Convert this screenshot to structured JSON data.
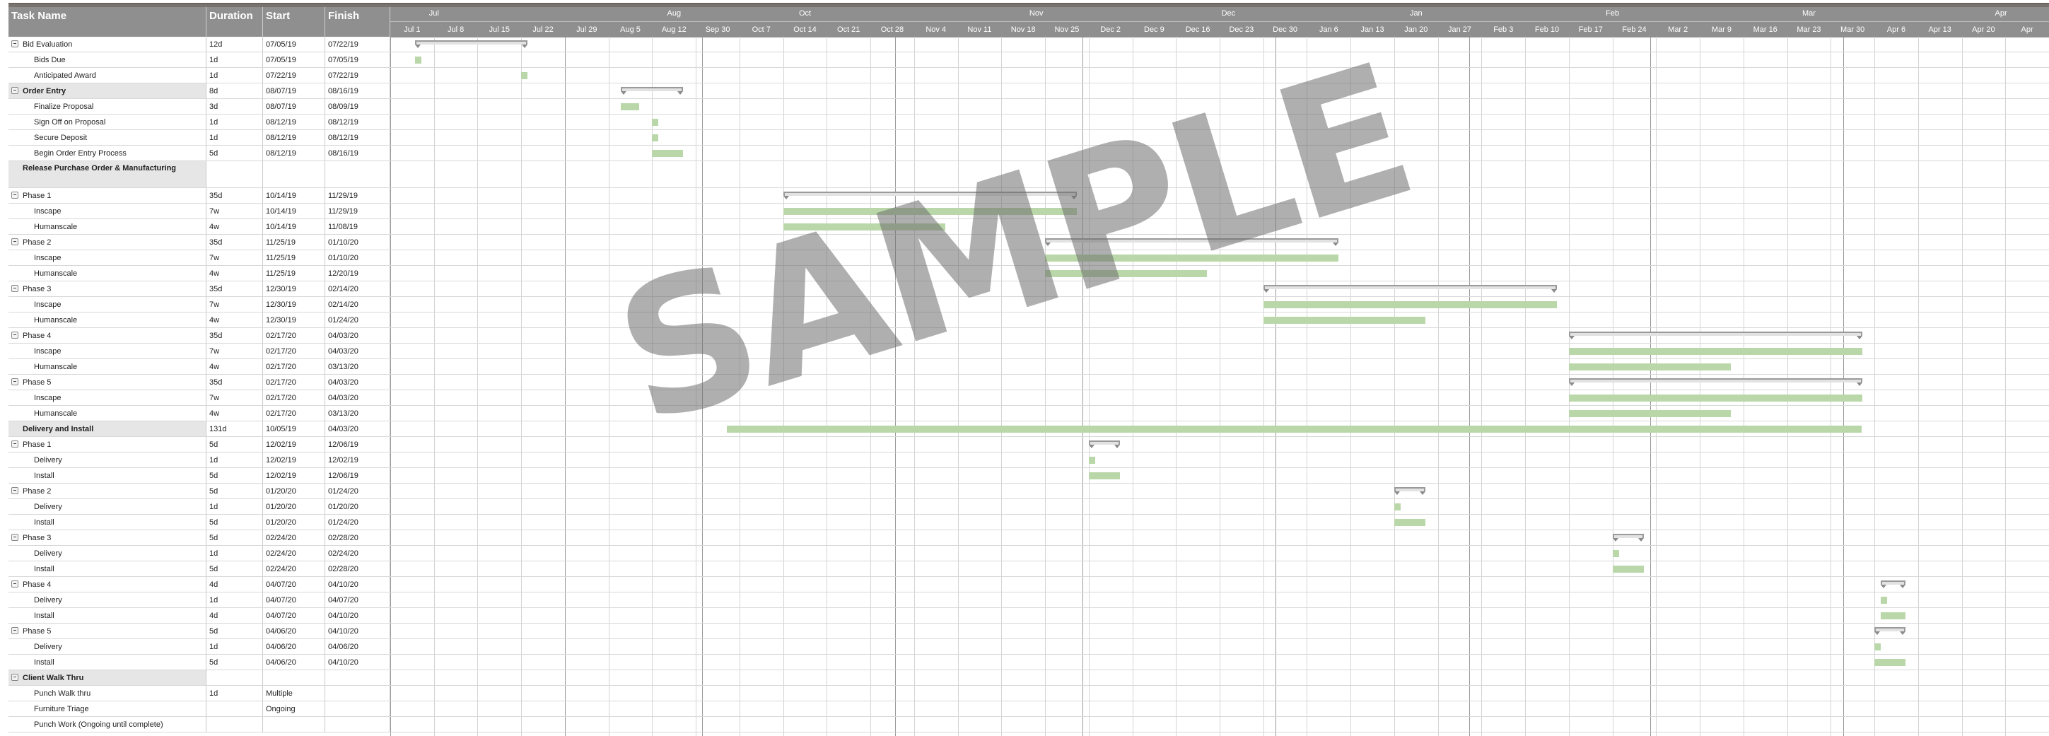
{
  "columns": {
    "task": "Task Name",
    "duration": "Duration",
    "start": "Start",
    "finish": "Finish"
  },
  "timeline": {
    "months": [
      {
        "label": "Jul",
        "wk": 1
      },
      {
        "label": "Aug",
        "wk": 6.5
      },
      {
        "label": "Oct",
        "wk": 9.5
      },
      {
        "label": "Nov",
        "wk": 14.8
      },
      {
        "label": "Dec",
        "wk": 19.2
      },
      {
        "label": "Jan",
        "wk": 23.5
      },
      {
        "label": "Feb",
        "wk": 28
      },
      {
        "label": "Mar",
        "wk": 32.5
      },
      {
        "label": "Apr",
        "wk": 36.9
      }
    ],
    "weeks": [
      "Jul 1",
      "Jul 8",
      "Jul 15",
      "Jul 22",
      "Jul 29",
      "Aug 5",
      "Aug 12",
      "Sep 30",
      "Oct 7",
      "Oct 14",
      "Oct 21",
      "Oct 28",
      "Nov 4",
      "Nov 11",
      "Nov 18",
      "Nov 25",
      "Dec 2",
      "Dec 9",
      "Dec 16",
      "Dec 23",
      "Dec 30",
      "Jan 6",
      "Jan 13",
      "Jan 20",
      "Jan 27",
      "Feb 3",
      "Feb 10",
      "Feb 17",
      "Feb 24",
      "Mar 2",
      "Mar 9",
      "Mar 16",
      "Mar 23",
      "Mar 30",
      "Apr 6",
      "Apr 13",
      "Apr 20",
      "Apr"
    ],
    "week_dates": [
      "2019-07-01",
      "2019-07-08",
      "2019-07-15",
      "2019-07-22",
      "2019-07-29",
      "2019-08-05",
      "2019-08-12",
      "2019-09-30",
      "2019-10-07",
      "2019-10-14",
      "2019-10-21",
      "2019-10-28",
      "2019-11-04",
      "2019-11-11",
      "2019-11-18",
      "2019-11-25",
      "2019-12-02",
      "2019-12-09",
      "2019-12-16",
      "2019-12-23",
      "2019-12-30",
      "2020-01-06",
      "2020-01-13",
      "2020-01-20",
      "2020-01-27",
      "2020-02-03",
      "2020-02-10",
      "2020-02-17",
      "2020-02-24",
      "2020-03-02",
      "2020-03-09",
      "2020-03-16",
      "2020-03-23",
      "2020-03-30",
      "2020-04-06",
      "2020-04-13",
      "2020-04-20",
      "2020-04-27"
    ],
    "month_boundaries": [
      "2019-07-01",
      "2019-07-29",
      "2019-10-01",
      "2019-11-01",
      "2019-12-01",
      "2020-01-01",
      "2020-02-01",
      "2020-03-01",
      "2020-04-01"
    ]
  },
  "tasks": [
    {
      "name": "Bid Evaluation",
      "dur": "12d",
      "start": "07/05/19",
      "finish": "07/22/19",
      "level": "g",
      "collapse": true,
      "type": "summary",
      "s": "2019-07-05",
      "f": "2019-07-22"
    },
    {
      "name": "Bids Due",
      "dur": "1d",
      "start": "07/05/19",
      "finish": "07/05/19",
      "level": "s",
      "type": "bar",
      "s": "2019-07-05",
      "f": "2019-07-05"
    },
    {
      "name": "Anticipated Award",
      "dur": "1d",
      "start": "07/22/19",
      "finish": "07/22/19",
      "level": "s",
      "type": "bar",
      "s": "2019-07-22",
      "f": "2019-07-22"
    },
    {
      "name": "Order Entry",
      "dur": "8d",
      "start": "08/07/19",
      "finish": "08/16/19",
      "level": "h",
      "collapse": true,
      "type": "summary",
      "s": "2019-08-07",
      "f": "2019-08-16"
    },
    {
      "name": "Finalize Proposal",
      "dur": "3d",
      "start": "08/07/19",
      "finish": "08/09/19",
      "level": "s",
      "type": "bar",
      "s": "2019-08-07",
      "f": "2019-08-09"
    },
    {
      "name": "Sign Off on Proposal",
      "dur": "1d",
      "start": "08/12/19",
      "finish": "08/12/19",
      "level": "s",
      "type": "bar",
      "s": "2019-08-12",
      "f": "2019-08-12"
    },
    {
      "name": "Secure Deposit",
      "dur": "1d",
      "start": "08/12/19",
      "finish": "08/12/19",
      "level": "s",
      "type": "bar",
      "s": "2019-08-12",
      "f": "2019-08-12"
    },
    {
      "name": "Begin Order Entry Process",
      "dur": "5d",
      "start": "08/12/19",
      "finish": "08/16/19",
      "level": "s",
      "type": "bar",
      "s": "2019-08-12",
      "f": "2019-08-16"
    },
    {
      "name": "Release Purchase Order & Manufacturing",
      "dur": "",
      "start": "",
      "finish": "",
      "level": "h",
      "tall": true,
      "type": "none"
    },
    {
      "name": "Phase 1",
      "dur": "35d",
      "start": "10/14/19",
      "finish": "11/29/19",
      "level": "g",
      "collapse": true,
      "type": "summary",
      "s": "2019-10-14",
      "f": "2019-11-29"
    },
    {
      "name": "Inscape",
      "dur": "7w",
      "start": "10/14/19",
      "finish": "11/29/19",
      "level": "s",
      "type": "bar",
      "s": "2019-10-14",
      "f": "2019-11-29"
    },
    {
      "name": "Humanscale",
      "dur": "4w",
      "start": "10/14/19",
      "finish": "11/08/19",
      "level": "s",
      "type": "bar",
      "s": "2019-10-14",
      "f": "2019-11-08"
    },
    {
      "name": "Phase 2",
      "dur": "35d",
      "start": "11/25/19",
      "finish": "01/10/20",
      "level": "g",
      "collapse": true,
      "type": "summary",
      "s": "2019-11-25",
      "f": "2020-01-10"
    },
    {
      "name": "Inscape",
      "dur": "7w",
      "start": "11/25/19",
      "finish": "01/10/20",
      "level": "s",
      "type": "bar",
      "s": "2019-11-25",
      "f": "2020-01-10"
    },
    {
      "name": "Humanscale",
      "dur": "4w",
      "start": "11/25/19",
      "finish": "12/20/19",
      "level": "s",
      "type": "bar",
      "s": "2019-11-25",
      "f": "2019-12-20"
    },
    {
      "name": "Phase 3",
      "dur": "35d",
      "start": "12/30/19",
      "finish": "02/14/20",
      "level": "g",
      "collapse": true,
      "type": "summary",
      "s": "2019-12-30",
      "f": "2020-02-14"
    },
    {
      "name": "Inscape",
      "dur": "7w",
      "start": "12/30/19",
      "finish": "02/14/20",
      "level": "s",
      "type": "bar",
      "s": "2019-12-30",
      "f": "2020-02-14"
    },
    {
      "name": "Humanscale",
      "dur": "4w",
      "start": "12/30/19",
      "finish": "01/24/20",
      "level": "s",
      "type": "bar",
      "s": "2019-12-30",
      "f": "2020-01-24"
    },
    {
      "name": "Phase 4",
      "dur": "35d",
      "start": "02/17/20",
      "finish": "04/03/20",
      "level": "g",
      "collapse": true,
      "type": "summary",
      "s": "2020-02-17",
      "f": "2020-04-03"
    },
    {
      "name": "Inscape",
      "dur": "7w",
      "start": "02/17/20",
      "finish": "04/03/20",
      "level": "s",
      "type": "bar",
      "s": "2020-02-17",
      "f": "2020-04-03"
    },
    {
      "name": "Humanscale",
      "dur": "4w",
      "start": "02/17/20",
      "finish": "03/13/20",
      "level": "s",
      "type": "bar",
      "s": "2020-02-17",
      "f": "2020-03-13"
    },
    {
      "name": "Phase 5",
      "dur": "35d",
      "start": "02/17/20",
      "finish": "04/03/20",
      "level": "g",
      "collapse": true,
      "type": "summary",
      "s": "2020-02-17",
      "f": "2020-04-03"
    },
    {
      "name": "Inscape",
      "dur": "7w",
      "start": "02/17/20",
      "finish": "04/03/20",
      "level": "s",
      "type": "bar",
      "s": "2020-02-17",
      "f": "2020-04-03"
    },
    {
      "name": "Humanscale",
      "dur": "4w",
      "start": "02/17/20",
      "finish": "03/13/20",
      "level": "s",
      "type": "bar",
      "s": "2020-02-17",
      "f": "2020-03-13"
    },
    {
      "name": "Delivery and Install",
      "dur": "131d",
      "start": "10/05/19",
      "finish": "04/03/20",
      "level": "h",
      "type": "bar",
      "s": "2019-10-05",
      "f": "2020-04-03"
    },
    {
      "name": "Phase 1",
      "dur": "5d",
      "start": "12/02/19",
      "finish": "12/06/19",
      "level": "g",
      "collapse": true,
      "type": "summary",
      "s": "2019-12-02",
      "f": "2019-12-06"
    },
    {
      "name": "Delivery",
      "dur": "1d",
      "start": "12/02/19",
      "finish": "12/02/19",
      "level": "s",
      "type": "bar",
      "s": "2019-12-02",
      "f": "2019-12-02"
    },
    {
      "name": "Install",
      "dur": "5d",
      "start": "12/02/19",
      "finish": "12/06/19",
      "level": "s",
      "type": "bar",
      "s": "2019-12-02",
      "f": "2019-12-06"
    },
    {
      "name": "Phase 2",
      "dur": "5d",
      "start": "01/20/20",
      "finish": "01/24/20",
      "level": "g",
      "collapse": true,
      "type": "summary",
      "s": "2020-01-20",
      "f": "2020-01-24"
    },
    {
      "name": "Delivery",
      "dur": "1d",
      "start": "01/20/20",
      "finish": "01/20/20",
      "level": "s",
      "type": "bar",
      "s": "2020-01-20",
      "f": "2020-01-20"
    },
    {
      "name": "Install",
      "dur": "5d",
      "start": "01/20/20",
      "finish": "01/24/20",
      "level": "s",
      "type": "bar",
      "s": "2020-01-20",
      "f": "2020-01-24"
    },
    {
      "name": "Phase 3",
      "dur": "5d",
      "start": "02/24/20",
      "finish": "02/28/20",
      "level": "g",
      "collapse": true,
      "type": "summary",
      "s": "2020-02-24",
      "f": "2020-02-28"
    },
    {
      "name": "Delivery",
      "dur": "1d",
      "start": "02/24/20",
      "finish": "02/24/20",
      "level": "s",
      "type": "bar",
      "s": "2020-02-24",
      "f": "2020-02-24"
    },
    {
      "name": "Install",
      "dur": "5d",
      "start": "02/24/20",
      "finish": "02/28/20",
      "level": "s",
      "type": "bar",
      "s": "2020-02-24",
      "f": "2020-02-28"
    },
    {
      "name": "Phase 4",
      "dur": "4d",
      "start": "04/07/20",
      "finish": "04/10/20",
      "level": "g",
      "collapse": true,
      "type": "summary",
      "s": "2020-04-07",
      "f": "2020-04-10"
    },
    {
      "name": "Delivery",
      "dur": "1d",
      "start": "04/07/20",
      "finish": "04/07/20",
      "level": "s",
      "type": "bar",
      "s": "2020-04-07",
      "f": "2020-04-07"
    },
    {
      "name": "Install",
      "dur": "4d",
      "start": "04/07/20",
      "finish": "04/10/20",
      "level": "s",
      "type": "bar",
      "s": "2020-04-07",
      "f": "2020-04-10"
    },
    {
      "name": "Phase 5",
      "dur": "5d",
      "start": "04/06/20",
      "finish": "04/10/20",
      "level": "g",
      "collapse": true,
      "type": "summary",
      "s": "2020-04-06",
      "f": "2020-04-10"
    },
    {
      "name": "Delivery",
      "dur": "1d",
      "start": "04/06/20",
      "finish": "04/06/20",
      "level": "s",
      "type": "bar",
      "s": "2020-04-06",
      "f": "2020-04-06"
    },
    {
      "name": "Install",
      "dur": "5d",
      "start": "04/06/20",
      "finish": "04/10/20",
      "level": "s",
      "type": "bar",
      "s": "2020-04-06",
      "f": "2020-04-10"
    },
    {
      "name": "Client Walk Thru",
      "dur": "",
      "start": "",
      "finish": "",
      "level": "h",
      "collapse": true,
      "type": "none"
    },
    {
      "name": "Punch Walk thru",
      "dur": "1d",
      "start": "Multiple",
      "finish": "",
      "level": "s",
      "type": "none"
    },
    {
      "name": "Furniture Triage",
      "dur": "",
      "start": "Ongoing",
      "finish": "",
      "level": "s",
      "type": "none"
    },
    {
      "name": "Punch Work (Ongoing until complete)",
      "dur": "",
      "start": "",
      "finish": "",
      "level": "s",
      "type": "none"
    }
  ],
  "watermark": "SAMPLE",
  "colors": {
    "header": "#8f8f8f",
    "task_bar": "#b9d7a8",
    "summary_bar": "#9a9a9a",
    "section_fill": "#e6e6e6"
  }
}
